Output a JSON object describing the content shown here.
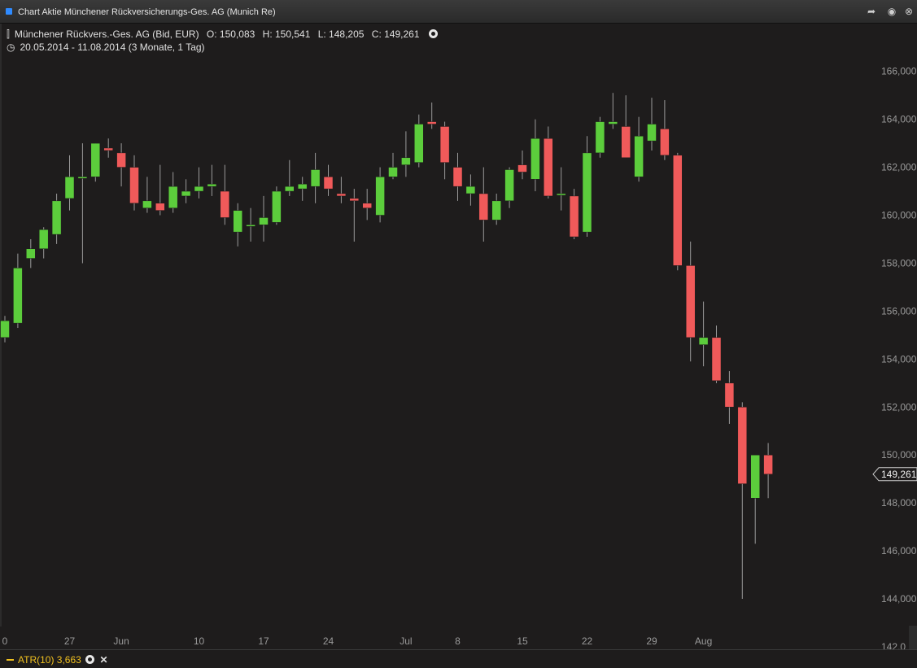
{
  "window": {
    "title": "Chart Aktie Münchener Rückversicherungs-Ges. AG (Munich Re)"
  },
  "header": {
    "instrument": "Münchener Rückvers.-Ges. AG (Bid, EUR)",
    "open": "O: 150,083",
    "high": "H: 150,541",
    "low": "L: 148,205",
    "close": "C: 149,261",
    "period": "20.05.2014 - 11.08.2014 (3 Monate, 1 Tag)"
  },
  "last_price_label": "149,261",
  "atr": {
    "label": "ATR(10)",
    "value": "3,663",
    "close_glyph": "✕"
  },
  "colors": {
    "up": "#5ccd3c",
    "down": "#f05a5a",
    "wick": "#9a9a9a",
    "background": "#1e1c1c",
    "atr": "#f0c020"
  },
  "chart_data": {
    "type": "candlestick",
    "ylim": [
      142,
      166.6
    ],
    "y_ticks": [
      "166,000",
      "164,000",
      "162,000",
      "160,000",
      "158,000",
      "156,000",
      "154,000",
      "152,000",
      "150,000",
      "148,000",
      "146,000",
      "144,000",
      "142,0"
    ],
    "y_tick_values": [
      166,
      164,
      162,
      160,
      158,
      156,
      154,
      152,
      150,
      148,
      146,
      144,
      142
    ],
    "x_tick_labels": [
      {
        "label": "0",
        "index": 0
      },
      {
        "label": "27",
        "index": 5
      },
      {
        "label": "Jun",
        "index": 9
      },
      {
        "label": "10",
        "index": 15
      },
      {
        "label": "17",
        "index": 20
      },
      {
        "label": "24",
        "index": 25
      },
      {
        "label": "Jul",
        "index": 31
      },
      {
        "label": "8",
        "index": 35
      },
      {
        "label": "15",
        "index": 40
      },
      {
        "label": "22",
        "index": 45
      },
      {
        "label": "29",
        "index": 50
      },
      {
        "label": "Aug",
        "index": 54
      }
    ],
    "candles": [
      {
        "o": 154.9,
        "h": 155.8,
        "l": 154.7,
        "c": 155.6
      },
      {
        "o": 155.5,
        "h": 158.4,
        "l": 155.3,
        "c": 157.8
      },
      {
        "o": 158.2,
        "h": 159.0,
        "l": 157.8,
        "c": 158.6
      },
      {
        "o": 158.6,
        "h": 159.5,
        "l": 158.2,
        "c": 159.4
      },
      {
        "o": 159.2,
        "h": 160.9,
        "l": 158.8,
        "c": 160.6
      },
      {
        "o": 160.7,
        "h": 162.5,
        "l": 160.2,
        "c": 161.6
      },
      {
        "o": 161.6,
        "h": 163.0,
        "l": 158.0,
        "c": 161.6
      },
      {
        "o": 161.6,
        "h": 163.0,
        "l": 161.4,
        "c": 163.0
      },
      {
        "o": 162.8,
        "h": 163.2,
        "l": 162.4,
        "c": 162.7
      },
      {
        "o": 162.6,
        "h": 163.0,
        "l": 161.2,
        "c": 162.0
      },
      {
        "o": 162.0,
        "h": 162.5,
        "l": 160.2,
        "c": 160.5
      },
      {
        "o": 160.3,
        "h": 161.6,
        "l": 160.1,
        "c": 160.6
      },
      {
        "o": 160.5,
        "h": 162.1,
        "l": 160.0,
        "c": 160.2
      },
      {
        "o": 160.3,
        "h": 161.8,
        "l": 160.1,
        "c": 161.2
      },
      {
        "o": 160.8,
        "h": 161.5,
        "l": 160.5,
        "c": 161.0
      },
      {
        "o": 161.0,
        "h": 162.0,
        "l": 160.7,
        "c": 161.2
      },
      {
        "o": 161.2,
        "h": 162.1,
        "l": 160.8,
        "c": 161.3
      },
      {
        "o": 161.0,
        "h": 162.1,
        "l": 159.6,
        "c": 159.9
      },
      {
        "o": 159.3,
        "h": 160.5,
        "l": 158.7,
        "c": 160.2
      },
      {
        "o": 159.6,
        "h": 160.3,
        "l": 158.9,
        "c": 159.6
      },
      {
        "o": 159.6,
        "h": 160.8,
        "l": 158.9,
        "c": 159.9
      },
      {
        "o": 159.7,
        "h": 161.2,
        "l": 159.6,
        "c": 161.0
      },
      {
        "o": 161.0,
        "h": 162.3,
        "l": 160.8,
        "c": 161.2
      },
      {
        "o": 161.1,
        "h": 161.6,
        "l": 160.6,
        "c": 161.3
      },
      {
        "o": 161.2,
        "h": 162.6,
        "l": 160.5,
        "c": 161.9
      },
      {
        "o": 161.6,
        "h": 162.1,
        "l": 160.8,
        "c": 161.1
      },
      {
        "o": 160.9,
        "h": 161.6,
        "l": 160.5,
        "c": 160.8
      },
      {
        "o": 160.7,
        "h": 161.1,
        "l": 158.9,
        "c": 160.6
      },
      {
        "o": 160.5,
        "h": 161.1,
        "l": 159.8,
        "c": 160.3
      },
      {
        "o": 160.0,
        "h": 162.0,
        "l": 159.7,
        "c": 161.6
      },
      {
        "o": 161.6,
        "h": 162.6,
        "l": 161.5,
        "c": 162.0
      },
      {
        "o": 162.1,
        "h": 163.5,
        "l": 161.6,
        "c": 162.4
      },
      {
        "o": 162.2,
        "h": 164.2,
        "l": 162.0,
        "c": 163.8
      },
      {
        "o": 163.9,
        "h": 164.7,
        "l": 163.6,
        "c": 163.8
      },
      {
        "o": 163.7,
        "h": 163.9,
        "l": 161.5,
        "c": 162.2
      },
      {
        "o": 162.0,
        "h": 162.6,
        "l": 160.6,
        "c": 161.2
      },
      {
        "o": 160.9,
        "h": 161.7,
        "l": 160.4,
        "c": 161.2
      },
      {
        "o": 160.9,
        "h": 162.0,
        "l": 158.9,
        "c": 159.8
      },
      {
        "o": 159.8,
        "h": 160.9,
        "l": 159.6,
        "c": 160.6
      },
      {
        "o": 160.6,
        "h": 162.0,
        "l": 160.3,
        "c": 161.9
      },
      {
        "o": 162.1,
        "h": 162.7,
        "l": 161.5,
        "c": 161.8
      },
      {
        "o": 161.5,
        "h": 164.0,
        "l": 161.0,
        "c": 163.2
      },
      {
        "o": 163.2,
        "h": 163.7,
        "l": 160.7,
        "c": 160.8
      },
      {
        "o": 160.9,
        "h": 162.0,
        "l": 160.2,
        "c": 160.9
      },
      {
        "o": 160.8,
        "h": 161.1,
        "l": 159.0,
        "c": 159.1
      },
      {
        "o": 159.3,
        "h": 163.3,
        "l": 159.1,
        "c": 162.6
      },
      {
        "o": 162.6,
        "h": 164.1,
        "l": 162.4,
        "c": 163.9
      },
      {
        "o": 163.8,
        "h": 165.1,
        "l": 163.6,
        "c": 163.9
      },
      {
        "o": 163.7,
        "h": 165.0,
        "l": 162.4,
        "c": 162.4
      },
      {
        "o": 161.6,
        "h": 164.1,
        "l": 161.4,
        "c": 163.3
      },
      {
        "o": 163.1,
        "h": 164.9,
        "l": 162.7,
        "c": 163.8
      },
      {
        "o": 163.6,
        "h": 164.8,
        "l": 162.3,
        "c": 162.5
      },
      {
        "o": 162.5,
        "h": 162.6,
        "l": 157.7,
        "c": 157.9
      },
      {
        "o": 157.9,
        "h": 158.9,
        "l": 153.9,
        "c": 154.9
      },
      {
        "o": 154.6,
        "h": 156.4,
        "l": 153.7,
        "c": 154.9
      },
      {
        "o": 154.9,
        "h": 155.4,
        "l": 153.0,
        "c": 153.1
      },
      {
        "o": 153.0,
        "h": 153.5,
        "l": 151.3,
        "c": 152.0
      },
      {
        "o": 152.0,
        "h": 152.2,
        "l": 144.0,
        "c": 148.8
      },
      {
        "o": 148.2,
        "h": 150.0,
        "l": 146.3,
        "c": 150.0
      },
      {
        "o": 150.0,
        "h": 150.5,
        "l": 148.2,
        "c": 149.2
      }
    ]
  }
}
